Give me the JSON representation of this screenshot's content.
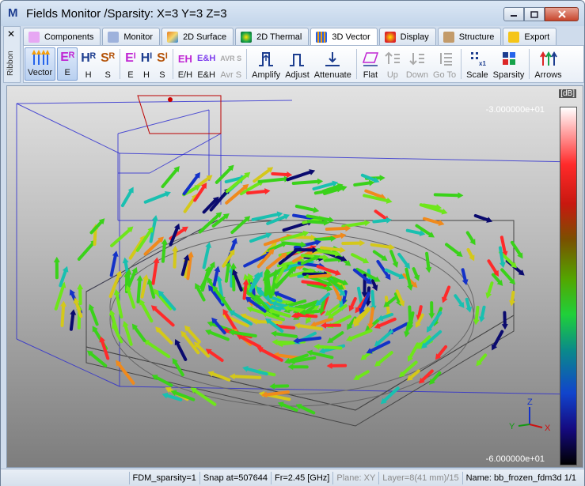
{
  "window": {
    "title": "Fields Monitor /Sparsity: X=3 Y=3 Z=3",
    "app_icon": "M",
    "minimize_icon": "minimize-icon",
    "maximize_icon": "maximize-icon",
    "close_icon": "close-icon"
  },
  "ribbon": {
    "side_label": "Ribbon",
    "close_glyph": "✕",
    "tabs": [
      {
        "label": "Components",
        "icon": "components-icon",
        "color": "#d946ef"
      },
      {
        "label": "Monitor",
        "icon": "monitor-icon",
        "color": "#1c3d8f"
      },
      {
        "label": "2D Surface",
        "icon": "surface-icon",
        "color": "#e67e22"
      },
      {
        "label": "2D Thermal",
        "icon": "thermal-icon",
        "color": "#16a34a"
      },
      {
        "label": "3D Vector",
        "icon": "vector-icon",
        "color": "#2563eb",
        "active": true
      },
      {
        "label": "Display",
        "icon": "display-icon",
        "color": "#dc2626"
      },
      {
        "label": "Structure",
        "icon": "structure-icon",
        "color": "#8b5e34"
      },
      {
        "label": "Export",
        "icon": "export-icon",
        "color": "#1c3d8f"
      }
    ],
    "tools": {
      "vector": "Vector",
      "e_r": "E",
      "h_r": "H",
      "s_r": "S",
      "e_i": "E",
      "h_i": "H",
      "s_i": "S",
      "e_h": "E/H",
      "e_and_h": "E&H",
      "avr_s": "Avr S",
      "amplify": "Amplify",
      "adjust": "Adjust",
      "attenuate": "Attenuate",
      "flat": "Flat",
      "up": "Up",
      "down": "Down",
      "go_to": "Go To",
      "scale": "Scale",
      "sparsity": "Sparsity",
      "arrows": "Arrows"
    },
    "tool_glyphs": {
      "e_r": "Eᴿ",
      "h_r": "Hᴿ",
      "s_r": "Sᴿ",
      "e_i": "Eᴵ",
      "h_i": "Hᴵ",
      "s_i": "Sᴵ",
      "eh": "EH",
      "e_and_h": "E&H",
      "avr": "AVR S"
    }
  },
  "viewport": {
    "units_label": "[dB]",
    "colorbar_max": "-3.000000e+01",
    "colorbar_min": "-6.000000e+01",
    "axis_labels": {
      "z": "Z",
      "y": "Y",
      "x": "X"
    },
    "colors": {
      "red": "#ff2a2a",
      "orange": "#f08a1c",
      "yellow": "#d4c81a",
      "green": "#3ad21a",
      "lime": "#6ee61a",
      "cyan": "#19c0b0",
      "blue": "#1432c8",
      "navy": "#0a0a6e"
    }
  },
  "status": {
    "sparsity": "FDM_sparsity=1",
    "snap": "Snap at=507644",
    "frequency": "Fr=2.45 [GHz]",
    "plane": "Plane: XY",
    "layer": "Layer=8(41 mm)/15",
    "name": "Name: bb_frozen_fdm3d 1/1"
  }
}
